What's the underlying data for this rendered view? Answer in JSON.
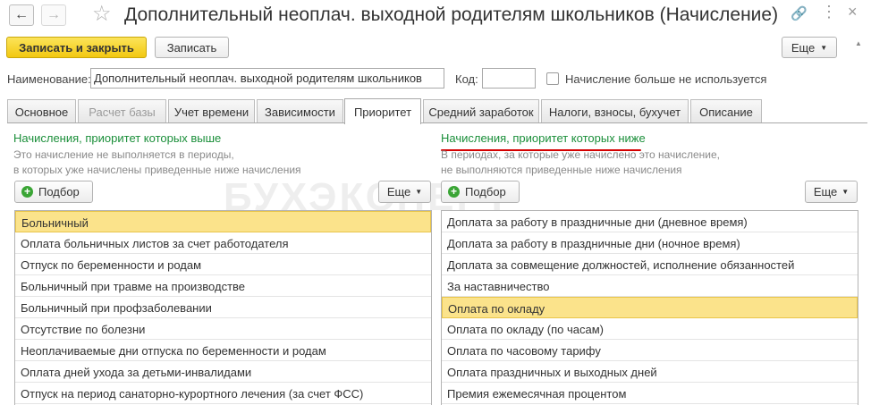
{
  "window": {
    "title": "Дополнительный неоплач. выходной родителям школьников (Начисление)"
  },
  "toolbar": {
    "save_close_label": "Записать и закрыть",
    "save_label": "Записать",
    "more_label": "Еще"
  },
  "form": {
    "name_label": "Наименование:",
    "name_value": "Дополнительный неоплач. выходной родителям школьников",
    "code_label": "Код:",
    "code_value": "",
    "not_used_label": "Начисление больше не используется"
  },
  "tabs": [
    {
      "label": "Основное"
    },
    {
      "label": "Расчет базы"
    },
    {
      "label": "Учет времени"
    },
    {
      "label": "Зависимости"
    },
    {
      "label": "Приоритет"
    },
    {
      "label": "Средний заработок"
    },
    {
      "label": "Налоги, взносы, бухучет"
    },
    {
      "label": "Описание"
    }
  ],
  "watermark": "БУХЭКСПЕРТ",
  "left_panel": {
    "title": "Начисления, приоритет которых выше",
    "desc_line1": "Это начисление не выполняется в периоды,",
    "desc_line2": "в которых уже начислены приведенные ниже начисления",
    "pick_label": "Подбор",
    "more_label": "Еще",
    "items": [
      "Больничный",
      "Оплата больничных листов за счет работодателя",
      "Отпуск по беременности и родам",
      "Больничный при травме на производстве",
      "Больничный при профзаболевании",
      "Отсутствие по болезни",
      "Неоплачиваемые дни отпуска по беременности и родам",
      "Оплата дней ухода за детьми-инвалидами",
      "Отпуск на период санаторно-курортного лечения (за счет ФСС)"
    ]
  },
  "right_panel": {
    "title": "Начисления, приоритет которых ниже",
    "desc_line1": "В периодах, за которые уже начислено это начисление,",
    "desc_line2": "не выполняются приведенные ниже начисления",
    "pick_label": "Подбор",
    "more_label": "Еще",
    "items": [
      "Доплата за работу в праздничные дни (дневное время)",
      "Доплата за работу в праздничные дни (ночное время)",
      "Доплата за совмещение должностей, исполнение обязанностей",
      "За наставничество",
      "Оплата по окладу",
      "Оплата по окладу (по часам)",
      "Оплата по часовому тарифу",
      "Оплата праздничных и выходных дней",
      "Премия ежемесячная процентом"
    ]
  }
}
